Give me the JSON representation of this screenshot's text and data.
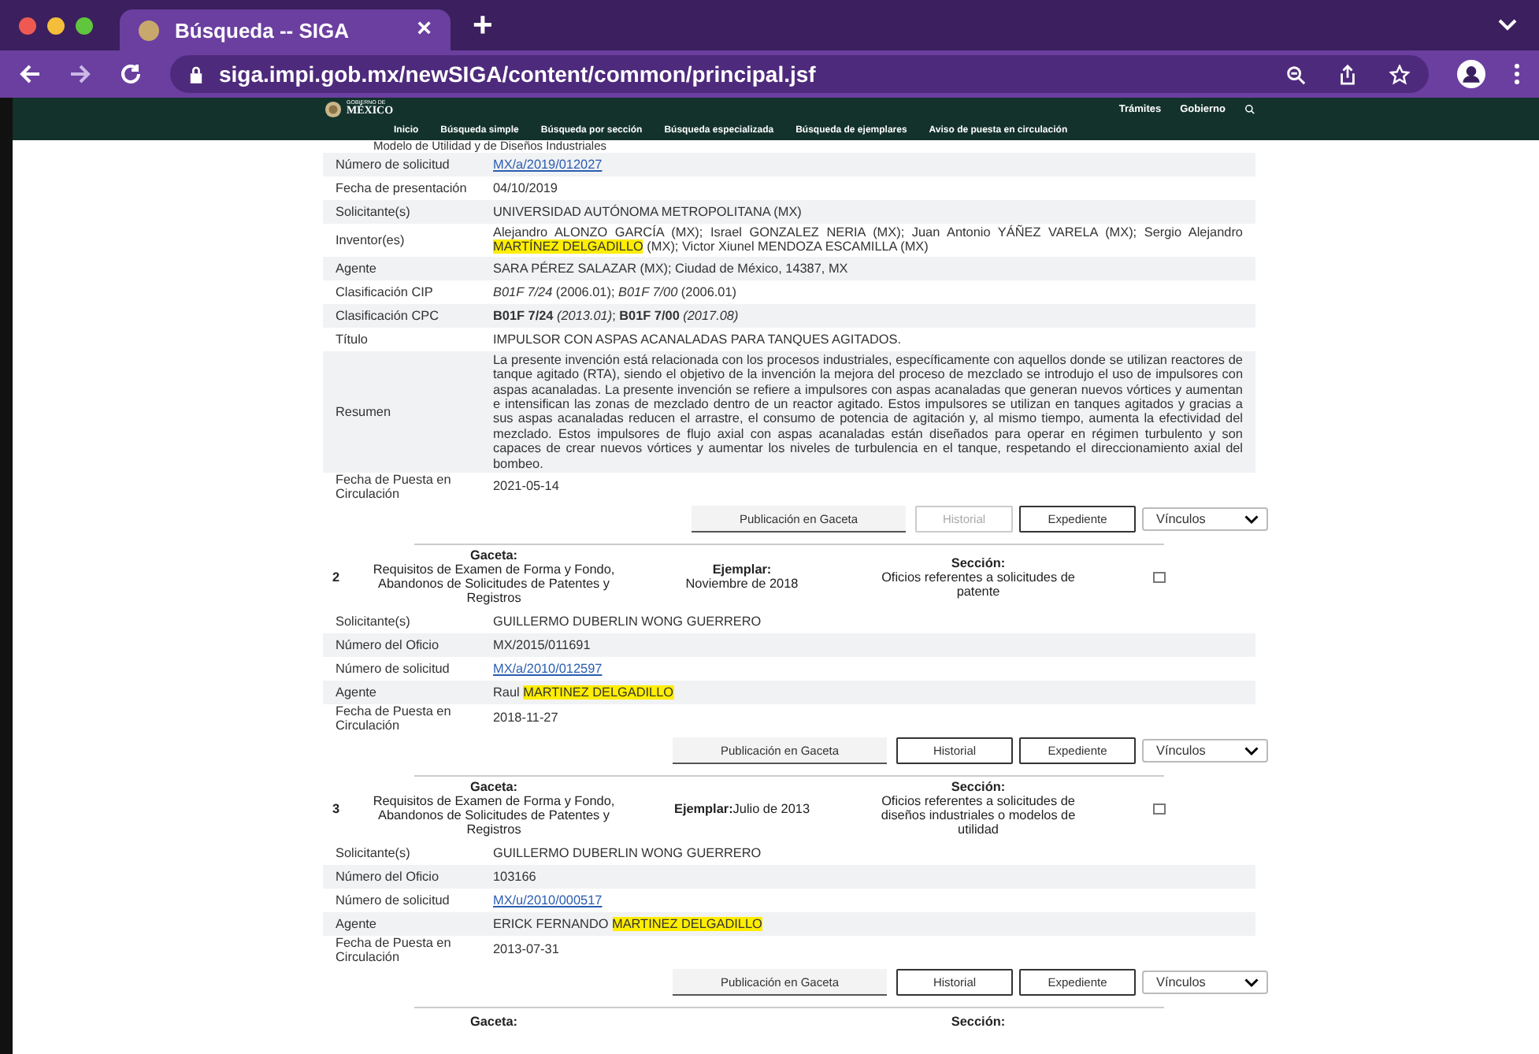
{
  "browser": {
    "tab_title": "Búsqueda -- SIGA",
    "tab_close": "×",
    "new_tab": "+",
    "url": "siga.impi.gob.mx/newSIGA/content/common/principal.jsf"
  },
  "site_header": {
    "logo_small": "GOBIERNO DE",
    "logo_big": "MÉXICO",
    "top_links": [
      "Trámites",
      "Gobierno"
    ],
    "nav": [
      "Inicio",
      "Búsqueda simple",
      "Búsqueda por sección",
      "Búsqueda especializada",
      "Búsqueda de ejemplares",
      "Aviso de puesta en circulación"
    ]
  },
  "cut_text": "Modelo de Utilidad y de Diseños Industriales",
  "records": [
    {
      "fields": [
        {
          "label": "Número de solicitud",
          "parts": [
            {
              "kind": "link",
              "text": "MX/a/2019/012027"
            }
          ]
        },
        {
          "label": "Fecha de presentación",
          "parts": [
            {
              "kind": "plain",
              "text": "04/10/2019"
            }
          ]
        },
        {
          "label": "Solicitante(s)",
          "parts": [
            {
              "kind": "plain",
              "text": "UNIVERSIDAD AUTÓNOMA METROPOLITANA (MX)"
            }
          ]
        },
        {
          "label": "Inventor(es)",
          "parts": [
            {
              "kind": "plain",
              "text": "Alejandro ALONZO GARCÍA (MX); Israel GONZALEZ NERIA (MX); Juan Antonio YÁÑEZ VARELA (MX); Sergio Alejandro "
            },
            {
              "kind": "highlight",
              "text": "MARTÍNEZ DELGADILLO"
            },
            {
              "kind": "plain",
              "text": " (MX); Victor Xiunel MENDOZA ESCAMILLA (MX)"
            }
          ]
        },
        {
          "label": "Agente",
          "parts": [
            {
              "kind": "plain",
              "text": "SARA PÉREZ SALAZAR (MX); Ciudad de México, 14387, MX"
            }
          ]
        },
        {
          "label": "Clasificación CIP",
          "parts": [
            {
              "kind": "plain",
              "text": "*B01F 7/24* (2006.01); *B01F 7/00* (2006.01)"
            }
          ]
        },
        {
          "label": "Clasificación CPC",
          "parts": [
            {
              "kind": "plain",
              "text": "**B01F 7/24** *(2013.01)*; **B01F 7/00** *(2017.08)*"
            }
          ]
        },
        {
          "label": "Título",
          "parts": [
            {
              "kind": "plain",
              "text": "IMPULSOR CON ASPAS ACANALADAS PARA TANQUES AGITADOS."
            }
          ]
        },
        {
          "label": "Resumen",
          "parts": [
            {
              "kind": "plain",
              "text": "La presente invención está relacionada con los procesos industriales, específicamente con aquellos donde se utilizan reactores de tanque agitado (RTA), siendo el objetivo de la invención la mejora del proceso de mezclado se introdujo el uso de impulsores con aspas acanaladas. La presente invención se refiere a impulsores con aspas acanaladas que generan nuevos vórtices y aumentan e intensifican las zonas de mezclado dentro de un reactor agitado. Estos impulsores se utilizan en tanques agitados y gracias a sus aspas acanaladas reducen el arrastre, el consumo de potencia de agitación y, al mismo tiempo, aumenta la efectividad del mezclado. Estos impulsores de flujo axial con aspas acanaladas están diseñados para operar en régimen turbulento y son capaces de crear nuevos vórtices y aumentar los niveles de turbulencia en el tanque, respetando el direccionamiento axial del bombeo."
            }
          ]
        },
        {
          "label": "Fecha de Puesta en Circulación",
          "parts": [
            {
              "kind": "plain",
              "text": "2021-05-14"
            }
          ]
        }
      ],
      "buttons": [
        {
          "label": "Publicación en Gaceta",
          "kind": "flat",
          "disabled": false
        },
        {
          "label": "Historial",
          "kind": "outline",
          "disabled": true
        },
        {
          "label": "Expediente",
          "kind": "outline",
          "disabled": false
        }
      ],
      "select": "Vínculos"
    },
    {
      "header": {
        "number": "2",
        "gaceta_label": "Gaceta:",
        "gaceta": "Requisitos de Examen de Forma y Fondo, Abandonos de Solicitudes de Patentes y Registros",
        "ejemplar_label": "Ejemplar:",
        "ejemplar": "Noviembre de 2018",
        "ejemplar_inline": false,
        "seccion_label": "Sección:",
        "seccion": "Oficios referentes a solicitudes de patente",
        "checked": false
      },
      "fields": [
        {
          "label": "Solicitante(s)",
          "parts": [
            {
              "kind": "plain",
              "text": "GUILLERMO DUBERLIN WONG GUERRERO"
            }
          ]
        },
        {
          "label": "Número del Oficio",
          "parts": [
            {
              "kind": "plain",
              "text": "MX/2015/011691"
            }
          ]
        },
        {
          "label": "Número de solicitud",
          "parts": [
            {
              "kind": "link",
              "text": "MX/a/2010/012597"
            }
          ]
        },
        {
          "label": "Agente",
          "parts": [
            {
              "kind": "plain",
              "text": "Raul "
            },
            {
              "kind": "highlight",
              "text": "MARTINEZ DELGADILLO"
            }
          ]
        },
        {
          "label": "Fecha de Puesta en Circulación",
          "parts": [
            {
              "kind": "plain",
              "text": "2018-11-27"
            }
          ]
        }
      ],
      "buttons": [
        {
          "label": "Publicación en Gaceta",
          "kind": "flat",
          "disabled": false
        },
        {
          "label": "Historial",
          "kind": "outline",
          "disabled": false
        },
        {
          "label": "Expediente",
          "kind": "outline",
          "disabled": false
        }
      ],
      "select": "Vínculos"
    },
    {
      "header": {
        "number": "3",
        "gaceta_label": "Gaceta:",
        "gaceta": "Requisitos de Examen de Forma y Fondo, Abandonos de Solicitudes de Patentes y Registros",
        "ejemplar_label": "Ejemplar:",
        "ejemplar": "Julio de 2013",
        "ejemplar_inline": true,
        "seccion_label": "Sección:",
        "seccion": "Oficios referentes a solicitudes de diseños industriales o modelos de utilidad",
        "checked": false
      },
      "fields": [
        {
          "label": "Solicitante(s)",
          "parts": [
            {
              "kind": "plain",
              "text": "GUILLERMO DUBERLIN WONG GUERRERO"
            }
          ]
        },
        {
          "label": "Número del Oficio",
          "parts": [
            {
              "kind": "plain",
              "text": "103166"
            }
          ]
        },
        {
          "label": "Número de solicitud",
          "parts": [
            {
              "kind": "link",
              "text": "MX/u/2010/000517"
            }
          ]
        },
        {
          "label": "Agente",
          "parts": [
            {
              "kind": "plain",
              "text": "ERICK FERNANDO "
            },
            {
              "kind": "highlight",
              "text": "MARTINEZ DELGADILLO"
            }
          ]
        },
        {
          "label": "Fecha de Puesta en Circulación",
          "parts": [
            {
              "kind": "plain",
              "text": "2013-07-31"
            }
          ]
        }
      ],
      "buttons": [
        {
          "label": "Publicación en Gaceta",
          "kind": "flat",
          "disabled": false
        },
        {
          "label": "Historial",
          "kind": "outline",
          "disabled": false
        },
        {
          "label": "Expediente",
          "kind": "outline",
          "disabled": false
        }
      ],
      "select": "Vínculos"
    }
  ],
  "next_header": {
    "gaceta_label": "Gaceta:",
    "seccion_label": "Sección:"
  }
}
